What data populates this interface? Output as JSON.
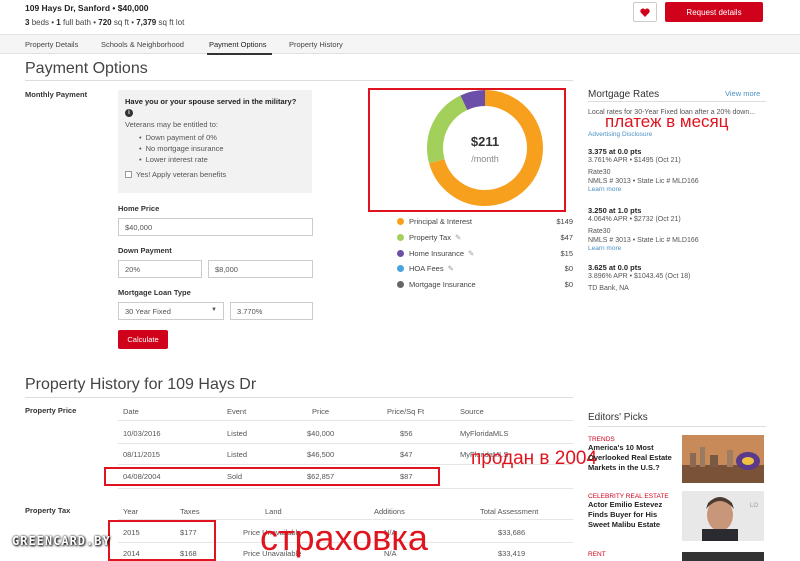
{
  "header": {
    "address": "109 Hays Dr, Sanford • $40,000",
    "beds_num": "3",
    "beds_label": "beds •",
    "bath_num": "1",
    "bath_label": "full bath •",
    "sqft_num": "720",
    "sqft_label": "sq ft •",
    "lot_num": "7,379",
    "lot_label": "sq ft lot",
    "request_button": "Request details"
  },
  "tabs": [
    "Property Details",
    "Schools & Neighborhood",
    "Payment Options",
    "Property History"
  ],
  "payment": {
    "title": "Payment Options",
    "monthly_label": "Monthly Payment",
    "veteran": {
      "question": "Have you or your spouse served in the military?",
      "info_icon": "i",
      "entitled": "Veterans may be entitled to:",
      "benefits": [
        "Down payment of 0%",
        "No mortgage insurance",
        "Lower interest rate"
      ],
      "checkbox_label": "Yes! Apply veteran benefits"
    },
    "home_price_label": "Home Price",
    "home_price_value": "$40,000",
    "down_payment_label": "Down Payment",
    "down_pct_value": "20%",
    "down_amt_value": "$8,000",
    "loan_type_label": "Mortgage Loan Type",
    "loan_type_value": "30 Year Fixed",
    "rate_value": "3.770%",
    "calculate_button": "Calculate",
    "donut_amount": "$211",
    "donut_period": "/month",
    "breakdown": [
      {
        "label": "Principal & Interest",
        "value": "$149",
        "color": "#f7a01d",
        "edit": false
      },
      {
        "label": "Property Tax",
        "value": "$47",
        "color": "#a3d05a",
        "edit": true
      },
      {
        "label": "Home Insurance",
        "value": "$15",
        "color": "#6b4fa8",
        "edit": true
      },
      {
        "label": "HOA Fees",
        "value": "$0",
        "color": "#4aa3df",
        "edit": true
      },
      {
        "label": "Mortgage Insurance",
        "value": "$0",
        "color": "#666666",
        "edit": false
      }
    ],
    "annotation": "платеж в месяц"
  },
  "mortgage_rates": {
    "title": "Mortgage Rates",
    "view_more": "View more",
    "intro": "Local rates for 30-Year Fixed loan after a 20% down...",
    "disclosure": "Advertising Disclosure",
    "offers": [
      {
        "rate": "3.375 at 0.0 pts",
        "detail": "3.761% APR • $1495 (Oct 21)",
        "lender": "Rate30",
        "license": "NMLS # 3013 • State Lic # MLD166",
        "link": "Learn more"
      },
      {
        "rate": "3.250 at 1.0 pts",
        "detail": "4.064% APR • $2732 (Oct 21)",
        "lender": "Rate30",
        "license": "NMLS # 3013 • State Lic # MLD166",
        "link": "Learn more"
      },
      {
        "rate": "3.625 at 0.0 pts",
        "detail": "3.896% APR • $1043.45 (Oct 18)",
        "lender": "TD Bank, NA",
        "license": "",
        "link": ""
      }
    ]
  },
  "history": {
    "title": "Property History for 109 Hays Dr",
    "price_label": "Property Price",
    "price_headers": [
      "Date",
      "Event",
      "Price",
      "Price/Sq Ft",
      "Source"
    ],
    "price_rows": [
      [
        "10/03/2016",
        "Listed",
        "$40,000",
        "$56",
        "MyFloridaMLS"
      ],
      [
        "08/11/2015",
        "Listed",
        "$46,500",
        "$47",
        "MyFloridaMLS"
      ],
      [
        "04/08/2004",
        "Sold",
        "$62,857",
        "$87",
        ""
      ]
    ],
    "sold_annotation": "продан в 2004",
    "tax_label": "Property Tax",
    "tax_headers": [
      "Year",
      "Taxes",
      "Land",
      "Additions",
      "Total Assessment"
    ],
    "tax_rows": [
      [
        "2015",
        "$177",
        "Price Unavailable",
        "N/A",
        "$33,686"
      ],
      [
        "2014",
        "$168",
        "Price Unavailable",
        "N/A",
        "$33,419"
      ]
    ],
    "tax_annotation": "страховка"
  },
  "editors_picks": {
    "title": "Editors' Picks",
    "items": [
      {
        "category": "TRENDS",
        "headline": "America's 10 Most Overlooked Real Estate Markets in the U.S.?"
      },
      {
        "category": "CELEBRITY REAL ESTATE",
        "headline": "Actor Emilio Estevez Finds Buyer for His Sweet Malibu Estate"
      },
      {
        "category": "RENT",
        "headline": ""
      }
    ]
  },
  "watermark": "GREENCARD.BY"
}
